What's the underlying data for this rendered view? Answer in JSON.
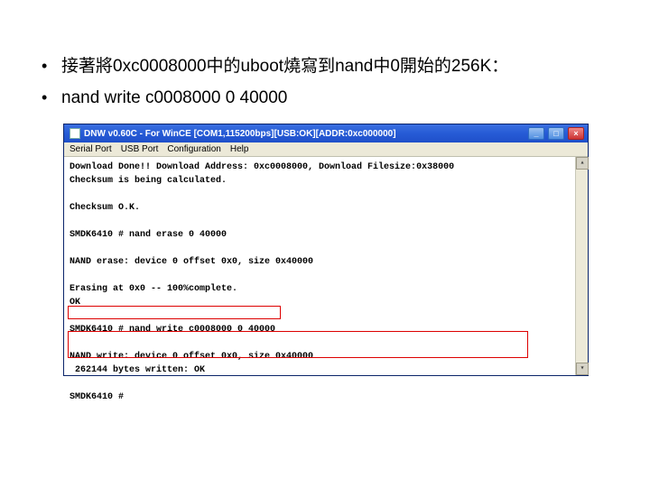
{
  "bullets": {
    "b1": "接著將0xc0008000中的uboot燒寫到nand中0開始的256K：",
    "b2": "nand write c0008000 0 40000"
  },
  "window": {
    "title": "DNW v0.60C - For WinCE   [COM1,115200bps][USB:OK][ADDR:0xc000000]",
    "menu": {
      "serial": "Serial Port",
      "usb": "USB Port",
      "config": "Configuration",
      "help": "Help"
    },
    "buttons": {
      "min": "_",
      "max": "□",
      "close": "×"
    },
    "scroll": {
      "up": "▴",
      "down": "▾"
    }
  },
  "terminal": {
    "l1": "Download Done!! Download Address: 0xc0008000, Download Filesize:0x38000",
    "l2": "Checksum is being calculated.",
    "l3": "Checksum O.K.",
    "l4": "SMDK6410 # nand erase 0 40000",
    "l5": "NAND erase: device 0 offset 0x0, size 0x40000",
    "l6": "Erasing at 0x0 -- 100%complete.",
    "l7": "OK",
    "l8": "SMDK6410 # nand write c0008000 0 40000",
    "l9": "NAND write: device 0 offset 0x0, size 0x40000",
    "l10": " 262144 bytes written: OK",
    "l11": "SMDK6410 #"
  }
}
